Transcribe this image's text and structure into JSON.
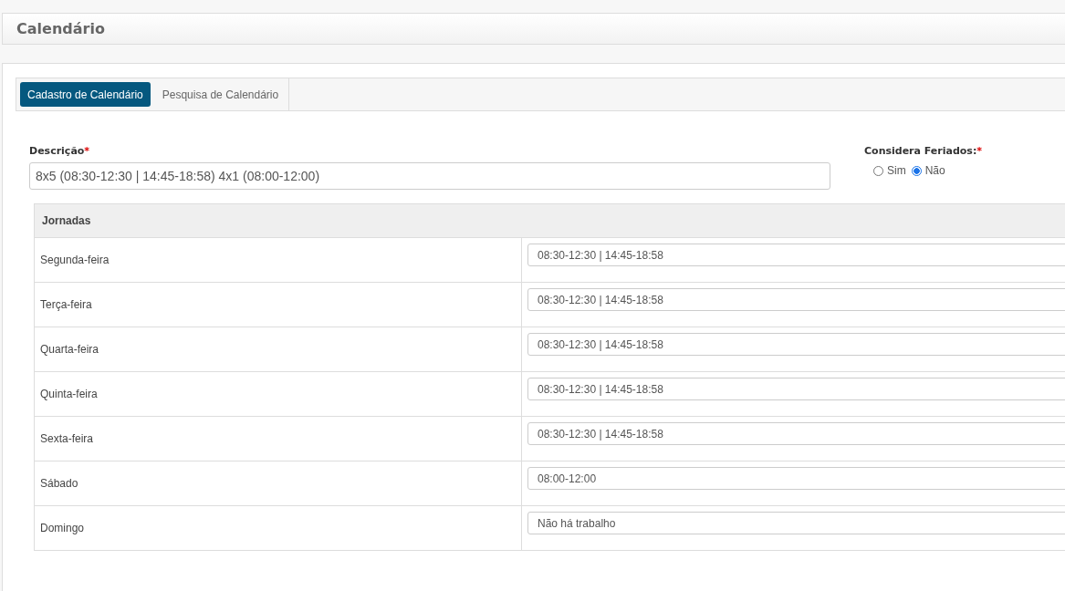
{
  "page_title": "Calendário",
  "tabs": [
    {
      "label": "Cadastro de Calendário",
      "selected": true
    },
    {
      "label": "Pesquisa de Calendário",
      "selected": false
    }
  ],
  "descricao": {
    "label": "Descrição",
    "required_mark": "*",
    "value": "8x5 (08:30-12:30 | 14:45-18:58) 4x1 (08:00-12:00)"
  },
  "considera_feriados": {
    "label": "Considera Feriados:",
    "required_mark": "*",
    "options": [
      {
        "label": "Sim",
        "selected": false
      },
      {
        "label": "Não",
        "selected": true
      }
    ]
  },
  "jornadas": {
    "title": "Jornadas",
    "rows": [
      {
        "day": "Segunda-feira",
        "value": "08:30-12:30 | 14:45-18:58"
      },
      {
        "day": "Terça-feira",
        "value": "08:30-12:30 | 14:45-18:58"
      },
      {
        "day": "Quarta-feira",
        "value": "08:30-12:30 | 14:45-18:58"
      },
      {
        "day": "Quinta-feira",
        "value": "08:30-12:30 | 14:45-18:58"
      },
      {
        "day": "Sexta-feira",
        "value": "08:30-12:30 | 14:45-18:58"
      },
      {
        "day": "Sábado",
        "value": "08:00-12:00"
      },
      {
        "day": "Domingo",
        "value": "Não há trabalho"
      }
    ]
  }
}
